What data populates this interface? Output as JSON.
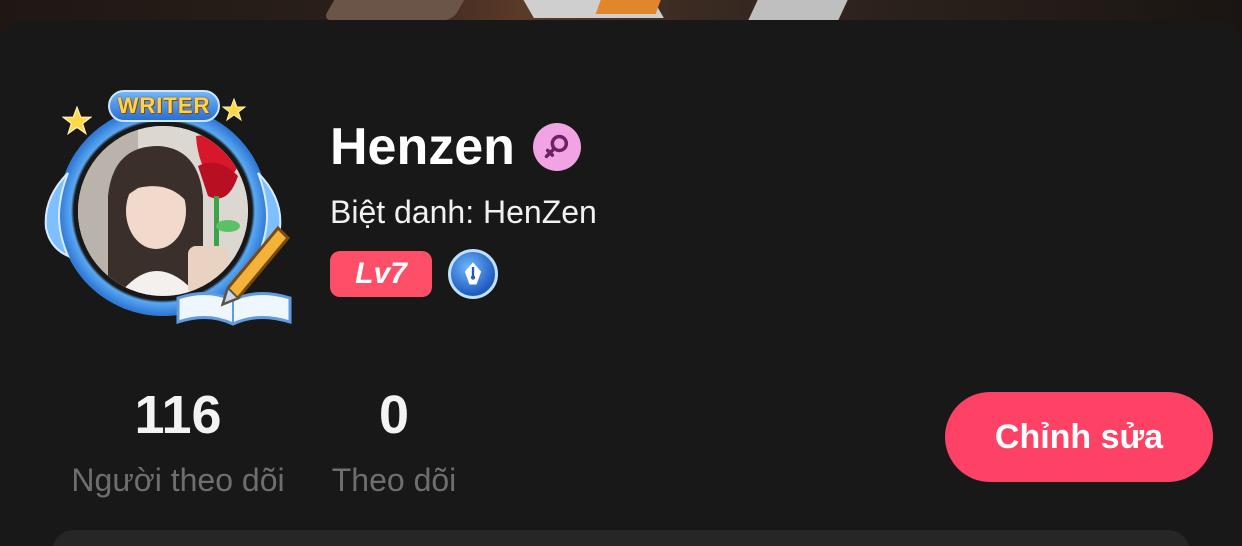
{
  "profile": {
    "name": "Henzen",
    "nickname": "Biệt danh: HenZen",
    "gender_icon": "female-icon",
    "frame_label": "WRITER",
    "level": "Lv7",
    "writer_badge_icon": "fountain-pen-icon"
  },
  "stats": {
    "followers_count": "116",
    "followers_label": "Người theo dõi",
    "following_count": "0",
    "following_label": "Theo dõi"
  },
  "actions": {
    "edit_label": "Chỉnh sửa"
  },
  "colors": {
    "background": "#181818",
    "accent": "#fe4266",
    "level_badge": "#fe4f69",
    "gender_badge": "#f2a3e3",
    "secondary_text": "#6e6e6e"
  }
}
